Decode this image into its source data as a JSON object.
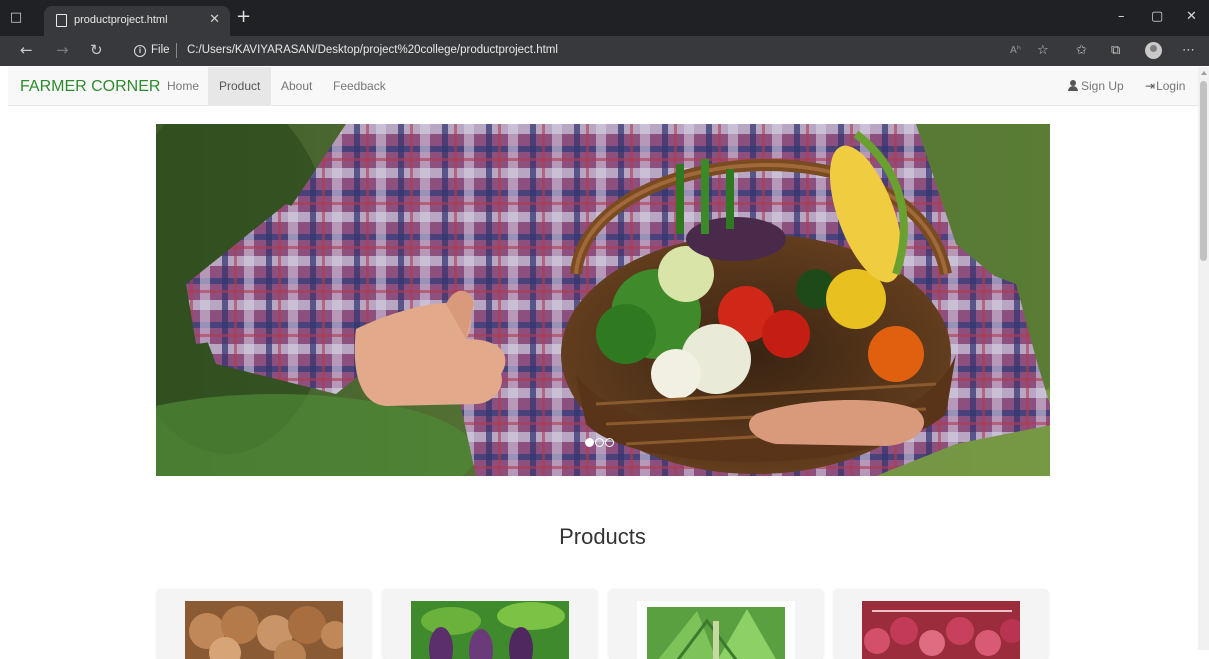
{
  "browser": {
    "tab_title": "productproject.html",
    "address_scheme": "File",
    "address_url": "C:/Users/KAVIYARASAN/Desktop/project%20college/productproject.html",
    "reader_icon_text": "Aᵃ"
  },
  "navbar": {
    "brand": "FARMER CORNER",
    "links": [
      "Home",
      "Product",
      "About",
      "Feedback"
    ],
    "active_link": "Product",
    "signup_label": "Sign Up",
    "login_label": "Login",
    "brand_color": "#2e8b2e"
  },
  "carousel": {
    "slide_count": 3,
    "active_index": 0,
    "image_description_icon": "farmer-with-vegetable-basket-image"
  },
  "products": {
    "title": "Products",
    "cards": [
      {
        "image": "coconut-product-image"
      },
      {
        "image": "eggplant-product-image"
      },
      {
        "image": "papaya-tree-product-image"
      },
      {
        "image": "onion-product-image"
      }
    ]
  }
}
